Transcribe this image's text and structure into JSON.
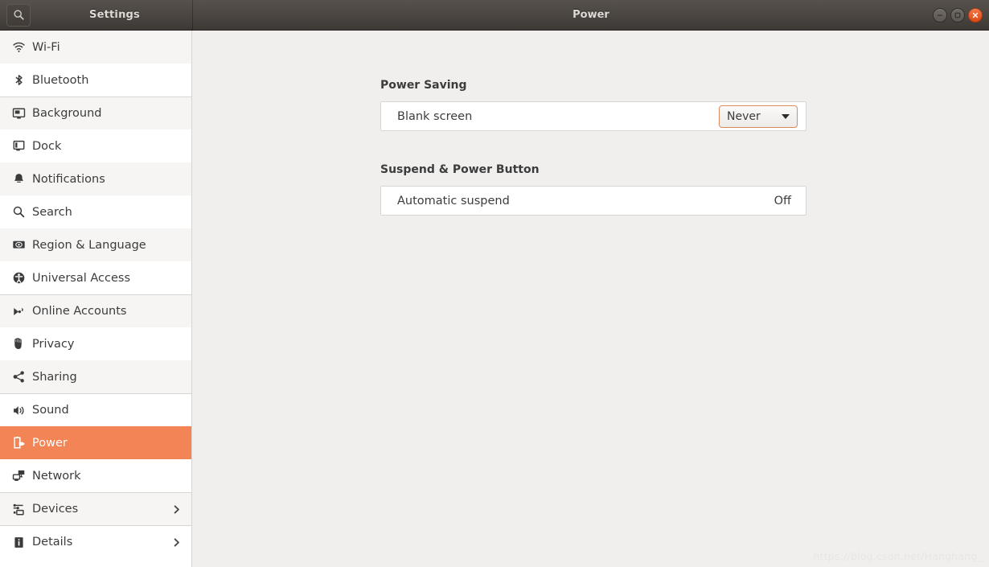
{
  "window": {
    "sidebar_title": "Settings",
    "title": "Power",
    "search_icon": "search-icon",
    "controls": {
      "minimize": "minimize-button",
      "maximize": "maximize-button",
      "close": "close-button"
    }
  },
  "sidebar": {
    "items": [
      {
        "label": "Wi-Fi",
        "icon": "wifi-icon",
        "selected": false,
        "chevron": false
      },
      {
        "label": "Bluetooth",
        "icon": "bluetooth-icon",
        "selected": false,
        "chevron": false
      },
      {
        "label": "Background",
        "icon": "background-icon",
        "selected": false,
        "chevron": false
      },
      {
        "label": "Dock",
        "icon": "dock-icon",
        "selected": false,
        "chevron": false
      },
      {
        "label": "Notifications",
        "icon": "bell-icon",
        "selected": false,
        "chevron": false
      },
      {
        "label": "Search",
        "icon": "search-icon",
        "selected": false,
        "chevron": false
      },
      {
        "label": "Region & Language",
        "icon": "region-language-icon",
        "selected": false,
        "chevron": false
      },
      {
        "label": "Universal Access",
        "icon": "universal-access-icon",
        "selected": false,
        "chevron": false
      },
      {
        "label": "Online Accounts",
        "icon": "online-accounts-icon",
        "selected": false,
        "chevron": false
      },
      {
        "label": "Privacy",
        "icon": "hand-icon",
        "selected": false,
        "chevron": false
      },
      {
        "label": "Sharing",
        "icon": "share-icon",
        "selected": false,
        "chevron": false
      },
      {
        "label": "Sound",
        "icon": "speaker-icon",
        "selected": false,
        "chevron": false
      },
      {
        "label": "Power",
        "icon": "power-battery-icon",
        "selected": true,
        "chevron": false
      },
      {
        "label": "Network",
        "icon": "network-icon",
        "selected": false,
        "chevron": false
      },
      {
        "label": "Devices",
        "icon": "devices-icon",
        "selected": false,
        "chevron": true
      },
      {
        "label": "Details",
        "icon": "info-icon",
        "selected": false,
        "chevron": true
      }
    ]
  },
  "main": {
    "sections": [
      {
        "title": "Power Saving",
        "rows": [
          {
            "label": "Blank screen",
            "control": "dropdown",
            "value": "Never"
          }
        ]
      },
      {
        "title": "Suspend & Power Button",
        "rows": [
          {
            "label": "Automatic suspend",
            "control": "text",
            "value": "Off"
          }
        ]
      }
    ]
  },
  "watermark": "https://blog.csdn.net/Hanghang_",
  "colors": {
    "accent_selected": "#f28455",
    "close_button": "#dd4814",
    "titlebar_dark": "#4a4541",
    "content_bg": "#f0efee",
    "row_alt_bg": "#f6f5f4",
    "combo_border": "#d98a5e"
  }
}
